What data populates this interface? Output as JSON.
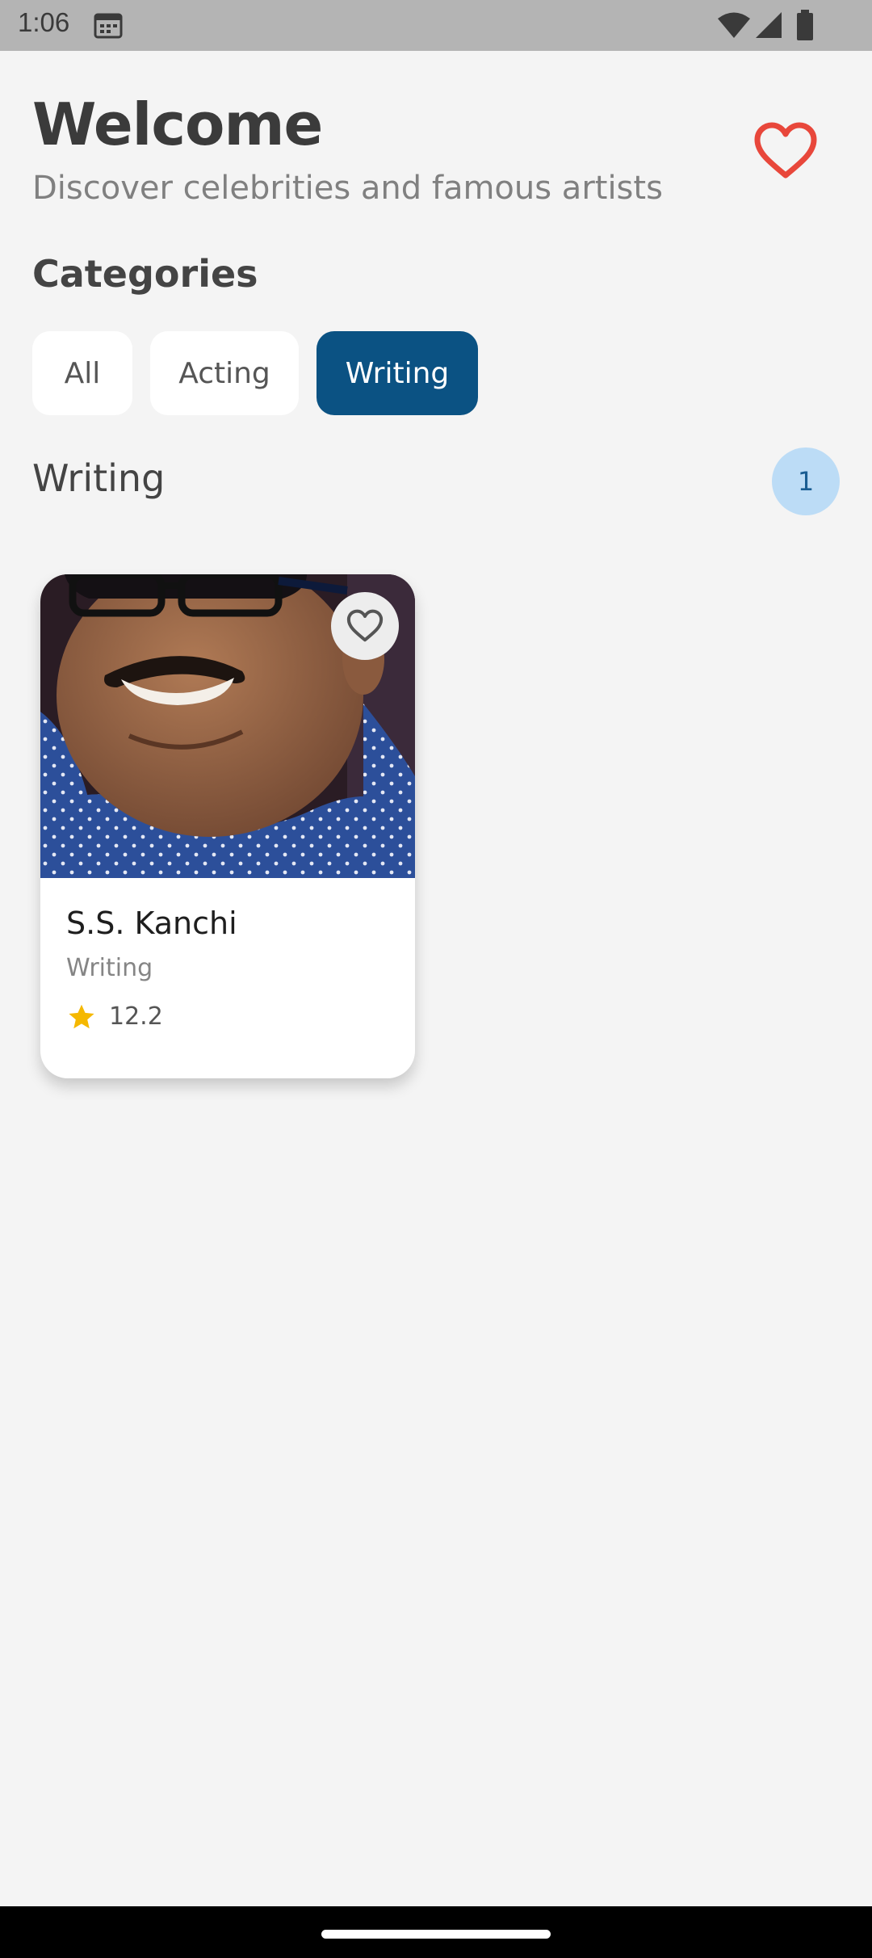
{
  "status_bar": {
    "time": "1:06",
    "icons": [
      "calendar-icon",
      "wifi-icon",
      "signal-icon",
      "battery-icon"
    ]
  },
  "header": {
    "title": "Welcome",
    "subtitle": "Discover celebrities and famous artists",
    "favorites_icon": "heart-outline-icon"
  },
  "categories": {
    "heading": "Categories",
    "chips": [
      {
        "label": "All",
        "selected": false
      },
      {
        "label": "Acting",
        "selected": false
      },
      {
        "label": "Writing",
        "selected": true
      }
    ]
  },
  "results": {
    "heading": "Writing",
    "count": "1",
    "items": [
      {
        "name": "S.S. Kanchi",
        "category": "Writing",
        "rating": "12.2",
        "favorite_icon": "heart-outline-icon",
        "rating_icon": "star-icon"
      }
    ]
  },
  "colors": {
    "accent": "#0b5283",
    "favorite_red": "#e8473b",
    "badge_bg": "#bcdcf6",
    "star": "#f5b800",
    "background": "#f4f4f4"
  }
}
